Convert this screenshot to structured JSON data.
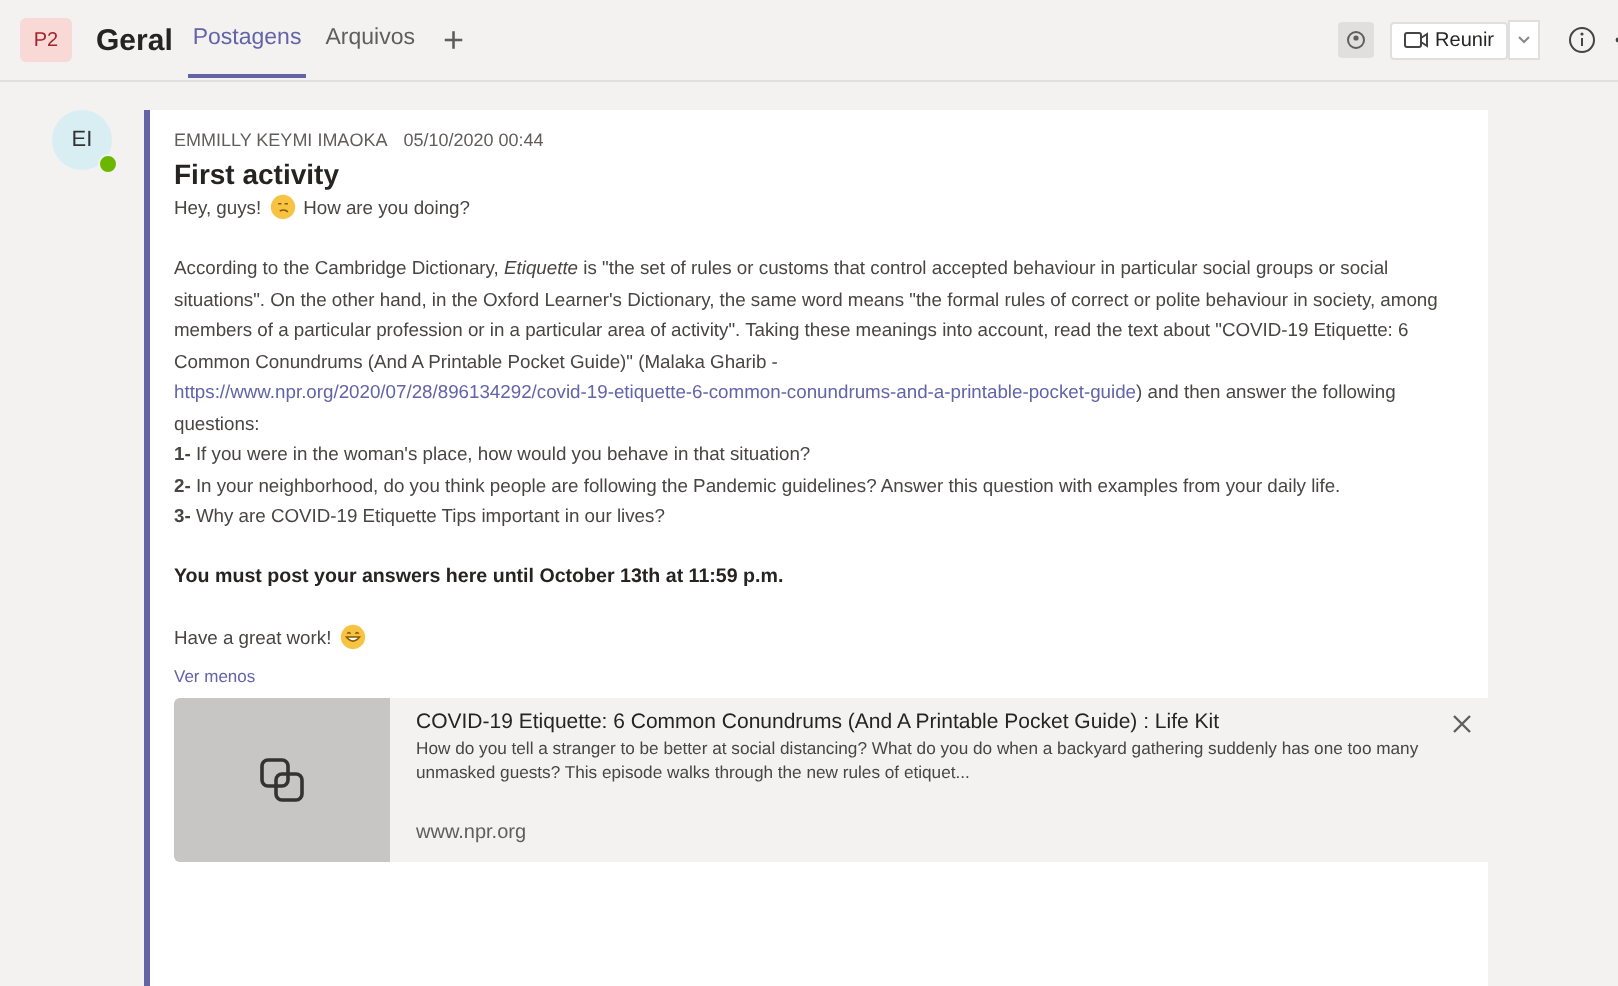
{
  "header": {
    "team_badge": "P2",
    "channel": "Geral",
    "tabs": [
      {
        "label": "Postagens",
        "selected": true
      },
      {
        "label": "Arquivos",
        "selected": false
      }
    ],
    "add_tab": "+",
    "meet_button": "Reunir"
  },
  "post": {
    "avatar": "EI",
    "online": true,
    "author": "EMMILLY KEYMI IMAOKA",
    "time": "05/10/2020 00:44",
    "subject": "First activity",
    "greeting_start": "Hey, guys!",
    "greeting_end": "How are you doing?",
    "paragraph_start": "According to the Cambridge Dictionary, *Etiquette* is \"the set of rules or customs that control accepted behaviour in particular social groups or social situations\". On the other hand, in the Oxford Learner's Dictionary, the same word means \"the formal rules of correct or polite behaviour in society, among members of a particular profession or in a particular area of activity\". Taking these meanings into account, read the text about \"COVID-19 Etiquette: 6 Common Conundrums (And A Printable Pocket Guide)\" (Malaka Gharib - ",
    "link": "https://www.npr.org/2020/07/28/896134292/covid-19-etiquette-6-common-conundrums-and-a-printable-pocket-guide",
    "paragraph_end": ") and then answer the following questions:",
    "questions": [
      "**1-** If you were in the woman's place, how would you behave in that situation?",
      "**2-** In your neighborhood, do you think people are following the Pandemic guidelines? Answer this question with examples from your daily life.",
      "**3-** Why are COVID-19 Etiquette Tips important in our lives?"
    ],
    "deadline": "You must post your answers here until October 13th at 11:59 p.m.",
    "closing": "Have a great work!",
    "see_less": "Ver menos",
    "preview": {
      "title": "COVID-19 Etiquette: 6 Common Conundrums (And A Printable Pocket Guide) : Life Kit",
      "description": "How do you tell a stranger to be better at social distancing? What do you do when a backyard gathering suddenly has one too many unmasked guests? This episode walks through the new rules of etiquet...",
      "domain": "www.npr.org"
    }
  }
}
